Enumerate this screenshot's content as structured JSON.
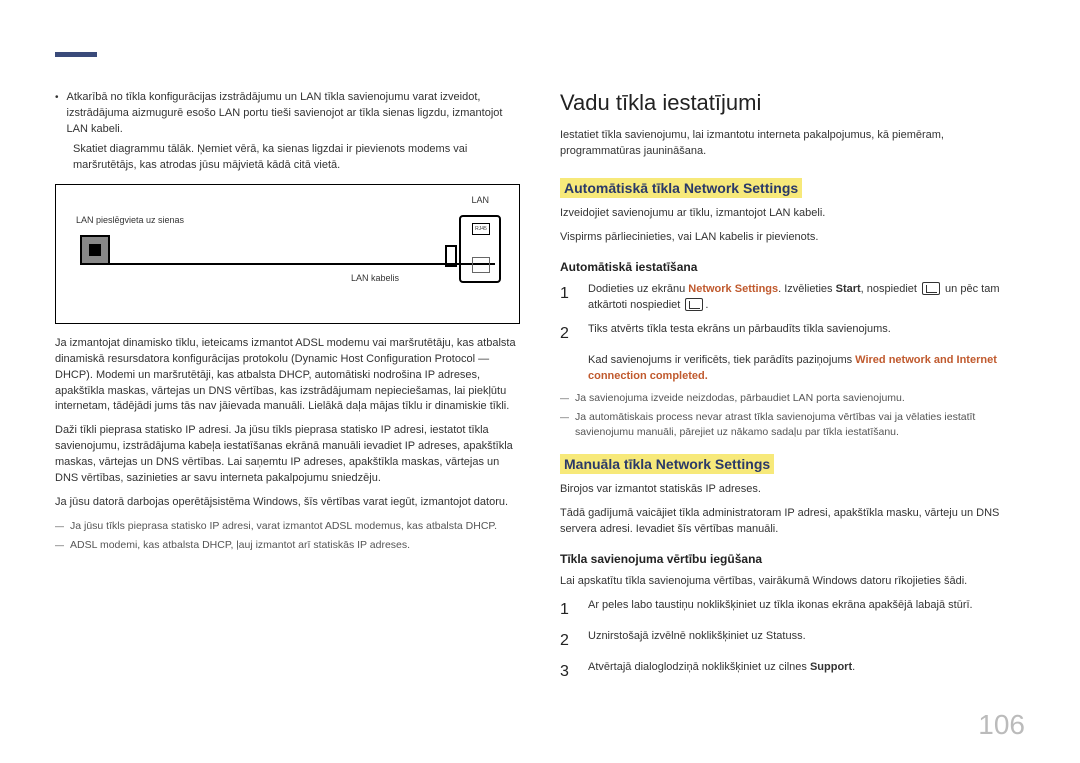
{
  "left": {
    "bullet1": "Atkarībā no tīkla konfigurācijas izstrādājumu un LAN tīkla savienojumu varat izveidot, izstrādājuma aizmugurē esošo LAN portu tieši savienojot ar tīkla sienas ligzdu, izmantojot LAN kabeli.",
    "bullet1_sub": "Skatiet diagrammu tālāk. Ņemiet vērā, ka sienas ligzdai ir pievienots modems vai maršrutētājs, kas atrodas jūsu mājvietā kādā citā vietā.",
    "diagram": {
      "lan_label": "LAN",
      "wall_label": "LAN pieslēgvieta uz sienas",
      "cable_label": "LAN kabelis",
      "port_label": "RJ45"
    },
    "p1": "Ja izmantojat dinamisko tīklu, ieteicams izmantot ADSL modemu vai maršrutētāju, kas atbalsta dinamiskā resursdatora konfigurācijas protokolu (Dynamic Host Configuration Protocol — DHCP). Modemi un maršrutētāji, kas atbalsta DHCP, automātiski nodrošina IP adreses, apakštīkla maskas, vārtejas un DNS vērtības, kas izstrādājumam nepieciešamas, lai piekļūtu internetam, tādējādi jums tās nav jāievada manuāli. Lielākā daļa mājas tīklu ir dinamiskie tīkli.",
    "p2": "Daži tīkli pieprasa statisko IP adresi. Ja jūsu tīkls pieprasa statisko IP adresi, iestatot tīkla savienojumu, izstrādājuma kabeļa iestatīšanas ekrānā manuāli ievadiet IP adreses, apakštīkla maskas, vārtejas un DNS vērtības. Lai saņemtu IP adreses, apakštīkla maskas, vārtejas un DNS vērtības, sazinieties ar savu interneta pakalpojumu sniedzēju.",
    "p3": "Ja jūsu datorā darbojas operētājsistēma Windows, šīs vērtības varat iegūt, izmantojot datoru.",
    "note1": "Ja jūsu tīkls pieprasa statisko IP adresi, varat izmantot ADSL modemus, kas atbalsta DHCP.",
    "note2": "ADSL modemi, kas atbalsta DHCP, ļauj izmantot arī statiskās IP adreses."
  },
  "right": {
    "h1": "Vadu tīkla iestatījumi",
    "intro": "Iestatiet tīkla savienojumu, lai izmantotu interneta pakalpojumus, kā piemēram, programmatūras jaunināšana.",
    "h2a": "Automātiskā tīkla Network Settings",
    "auto_p1": "Izveidojiet savienojumu ar tīklu, izmantojot LAN kabeli.",
    "auto_p2": "Vispirms pārliecinieties, vai LAN kabelis ir pievienots.",
    "h3a": "Automātiskā iestatīšana",
    "step1_pre": "Dodieties uz ekrānu ",
    "step1_accent1": "Network Settings",
    "step1_mid1": ". Izvēlieties ",
    "step1_bold1": "Start",
    "step1_mid2": ", nospiediet ",
    "step1_mid3": " un pēc tam atkārtoti nospiediet ",
    "step1_end": ".",
    "step2": "Tiks atvērts tīkla testa ekrāns un pārbaudīts tīkla savienojums.",
    "step2_sub_pre": "Kad savienojums ir verificēts, tiek parādīts paziņojums ",
    "step2_sub_accent": "Wired network and Internet connection completed.",
    "step2_note1": "Ja savienojuma izveide neizdodas, pārbaudiet LAN porta savienojumu.",
    "step2_note2": "Ja automātiskais process nevar atrast tīkla savienojuma vērtības vai ja vēlaties iestatīt savienojumu manuāli, pārejiet uz nākamo sadaļu par tīkla iestatīšanu.",
    "h2b": "Manuāla tīkla Network Settings",
    "man_p1": "Birojos var izmantot statiskās IP adreses.",
    "man_p2": "Tādā gadījumā vaicājiet tīkla administratoram IP adresi, apakštīkla masku, vārteju un DNS servera adresi. Ievadiet šīs vērtības manuāli.",
    "h3b": "Tīkla savienojuma vērtību iegūšana",
    "man_intro": "Lai apskatītu tīkla savienojuma vērtības, vairākumā Windows datoru rīkojieties šādi.",
    "mstep1": "Ar peles labo taustiņu noklikšķiniet uz tīkla ikonas ekrāna apakšējā labajā stūrī.",
    "mstep2": "Uznirstošajā izvēlnē noklikšķiniet uz Statuss.",
    "mstep3_pre": "Atvērtajā dialoglodziņā noklikšķiniet uz cilnes ",
    "mstep3_bold": "Support",
    "mstep3_end": "."
  },
  "page_number": "106"
}
